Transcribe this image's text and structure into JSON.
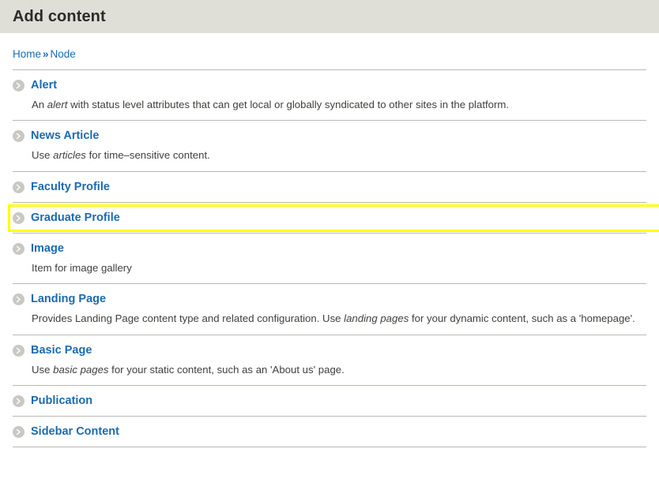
{
  "header": {
    "title": "Add content"
  },
  "breadcrumb": {
    "items": [
      {
        "label": "Home"
      },
      {
        "label": "Node"
      }
    ],
    "separator": "»"
  },
  "icons": {
    "arrow": "chevron-right-circle-icon"
  },
  "colors": {
    "header_bg": "#dfdfd8",
    "link": "#1b6ab0",
    "text": "#3f3f3d",
    "divider": "#b8b8b2",
    "highlight": "#ffff00",
    "icon_circle": "#c9c9c4",
    "icon_glyph": "#ffffff"
  },
  "content_types": [
    {
      "name": "Alert",
      "description_html": "An <em>alert</em> with status level attributes that can get local or globally syndicated to other sites in the platform.",
      "description_text": "An alert with status level attributes that can get local or globally syndicated to other sites in the platform.",
      "highlighted": false
    },
    {
      "name": "News Article",
      "description_html": "Use <em>articles</em> for time–sensitive content.",
      "description_text": "Use articles for time–sensitive content.",
      "highlighted": false
    },
    {
      "name": "Faculty Profile",
      "description_html": "",
      "description_text": "",
      "highlighted": false
    },
    {
      "name": "Graduate Profile",
      "description_html": "",
      "description_text": "",
      "highlighted": true
    },
    {
      "name": "Image",
      "description_html": "Item for image gallery",
      "description_text": "Item for image gallery",
      "highlighted": false
    },
    {
      "name": "Landing Page",
      "description_html": "Provides Landing Page content type and related configuration. Use <em>landing pages</em> for your dynamic content, such as a 'homepage'.",
      "description_text": "Provides Landing Page content type and related configuration. Use landing pages for your dynamic content, such as a 'homepage'.",
      "highlighted": false
    },
    {
      "name": "Basic Page",
      "description_html": "Use <em>basic pages</em> for your static content, such as an 'About us' page.",
      "description_text": "Use basic pages for your static content, such as an 'About us' page.",
      "highlighted": false
    },
    {
      "name": "Publication",
      "description_html": "",
      "description_text": "",
      "highlighted": false
    },
    {
      "name": "Sidebar Content",
      "description_html": "",
      "description_text": "",
      "highlighted": false
    }
  ]
}
